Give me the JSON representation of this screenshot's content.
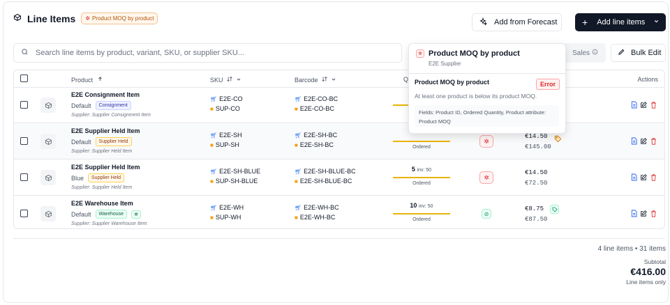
{
  "header": {
    "title": "Line Items",
    "moq_badge": "Product MOQ by product",
    "add_from_forecast": "Add from Forecast",
    "add_line_items": "Add line items"
  },
  "toolbar": {
    "search_placeholder": "Search line items by product, variant, SKU, or supplier SKU...",
    "sales_label": "Sales",
    "bulk_edit": "Bulk Edit"
  },
  "columns": {
    "product": "Product",
    "sku": "SKU",
    "barcode": "Barcode",
    "quantity": "Q",
    "actions": "Actions"
  },
  "rows": [
    {
      "name": "E2E Consignment Item",
      "variant": "Default",
      "tag": "Consignment",
      "supplier": "Supplier: Supplier Consignment Item",
      "sku": "E2E-CO",
      "supplier_sku": "SUP-CO",
      "barcode": "E2E-CO-BC",
      "supplier_barcode": "E2E-CO-BC",
      "qty": "",
      "inv": "",
      "ordered": "",
      "price": "",
      "total": ""
    },
    {
      "name": "E2E Supplier Held Item",
      "variant": "Default",
      "tag": "Supplier Held",
      "supplier": "Supplier: Supplier Held Item",
      "sku": "E2E-SH",
      "supplier_sku": "SUP-SH",
      "barcode": "E2E-SH-BC",
      "supplier_barcode": "E2E-SH-BC",
      "qty": "",
      "inv": "",
      "ordered": "Ordered",
      "price": "€14.50",
      "total": "€145.00"
    },
    {
      "name": "E2E Supplier Held Item",
      "variant": "Blue",
      "tag": "Supplier Held",
      "supplier": "Supplier: Supplier Held Item",
      "sku": "E2E-SH-BLUE",
      "supplier_sku": "SUP-SH-BLUE",
      "barcode": "E2E-SH-BLUE-BC",
      "supplier_barcode": "E2E-SH-BLUE-BC",
      "qty": "5",
      "inv": "inv: 50",
      "ordered": "Ordered",
      "price": "€14.50",
      "total": "€72.50"
    },
    {
      "name": "E2E Warehouse Item",
      "variant": "Default",
      "tag": "Warehouse",
      "supplier": "Supplier: Supplier Warehouse Item",
      "sku": "E2E-WH",
      "supplier_sku": "SUP-WH",
      "barcode": "E2E-WH-BC",
      "supplier_barcode": "E2E-WH-BC",
      "qty": "10",
      "inv": "inv: 50",
      "ordered": "Ordered",
      "price": "€8.75",
      "total": "€87.50"
    }
  ],
  "popover": {
    "title": "Product MOQ by product",
    "subtitle": "E2E Supplier",
    "rule_title": "Product MOQ by product",
    "status": "Error",
    "message": "At least one product is below its product MOQ.",
    "fields": "Fields: Product ID, Ordered Quantity, Product attribute: Product MOQ"
  },
  "summary": {
    "counts": "4 line items • 31 items",
    "subtotal_label": "Subtotal",
    "subtotal_value": "€416.00",
    "note": "Line items only"
  },
  "colors": {
    "accent_dark": "#111827",
    "error": "#dc2626",
    "warning": "#eab308",
    "ok": "#059669"
  }
}
